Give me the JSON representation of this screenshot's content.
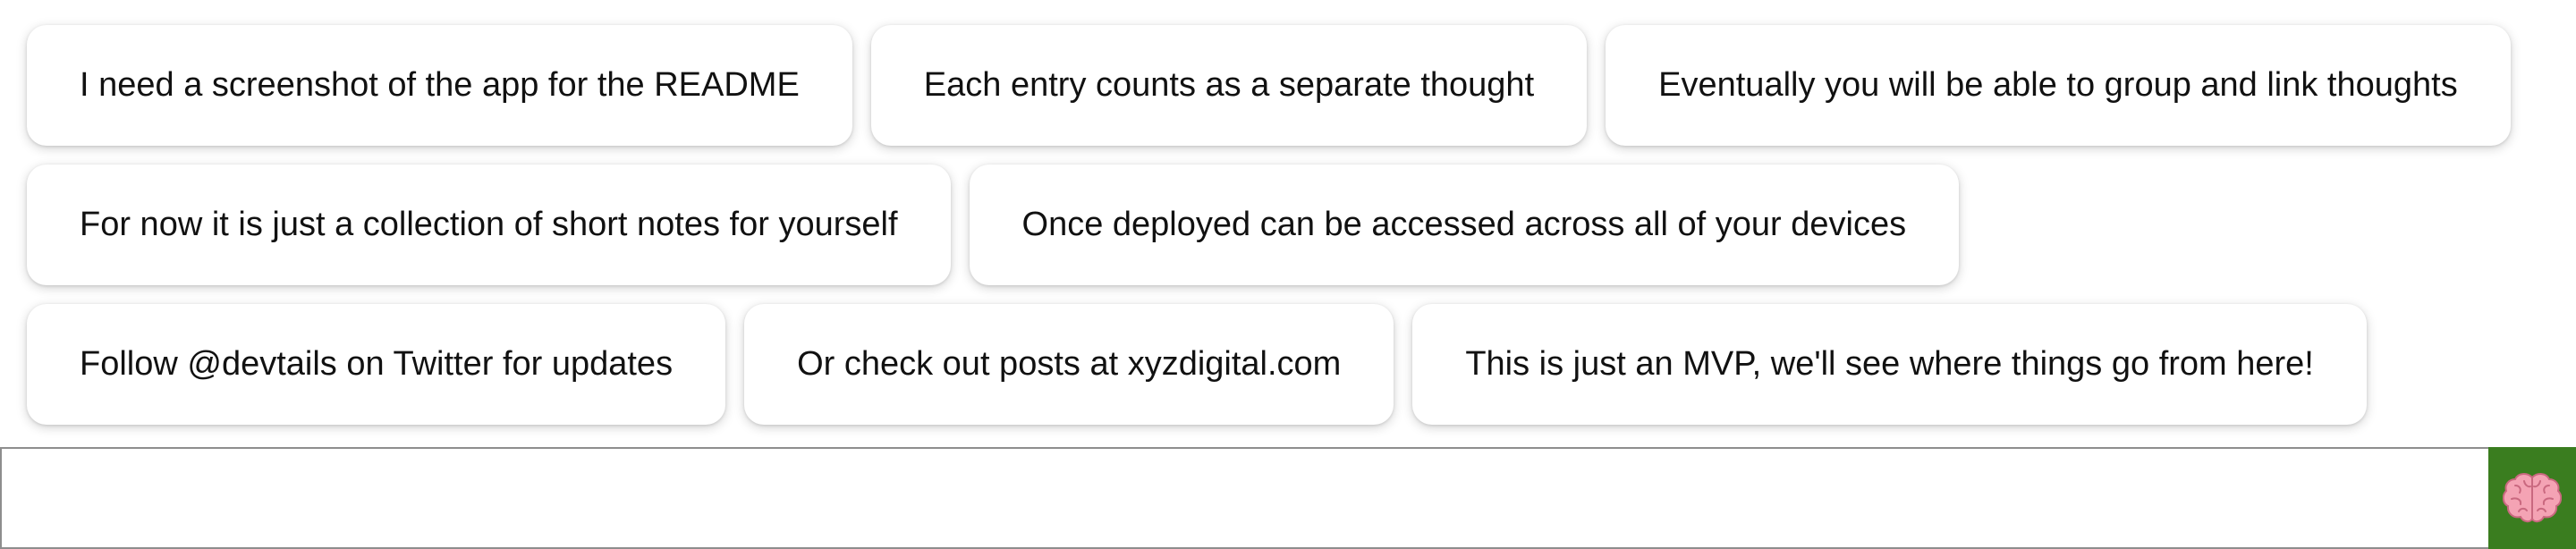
{
  "thoughts": [
    {
      "text": "I need a screenshot of the app for the README"
    },
    {
      "text": "Each entry counts as a separate thought"
    },
    {
      "text": "Eventually you will be able to group and link thoughts"
    },
    {
      "text": "For now it is just a collection of short notes for yourself"
    },
    {
      "text": "Once deployed can be accessed across all of your devices"
    },
    {
      "text": "Follow @devtails on Twitter for updates"
    },
    {
      "text": "Or check out posts at xyzdigital.com"
    },
    {
      "text": "This is just an MVP, we'll see where things go from here!"
    }
  ],
  "composer": {
    "input_value": "",
    "submit_icon": "brain-icon",
    "submit_color": "#3a7d1f"
  }
}
